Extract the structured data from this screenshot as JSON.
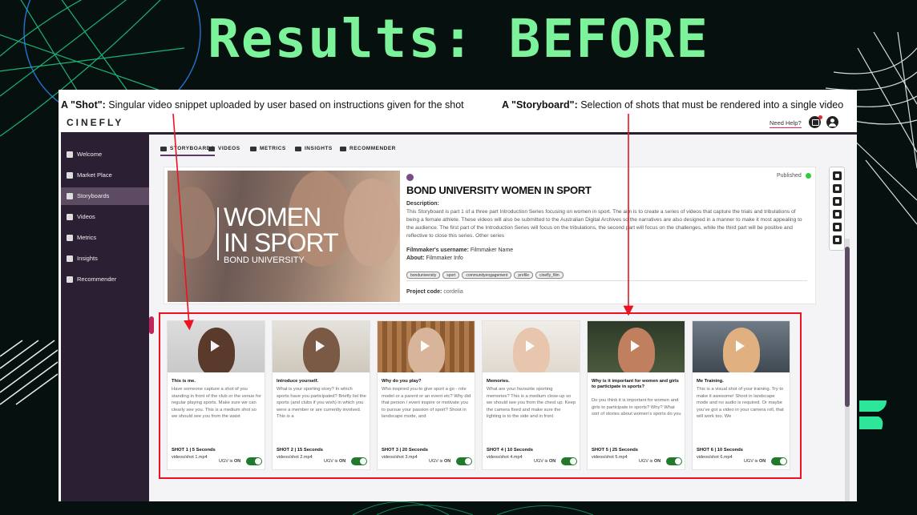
{
  "slide": {
    "title": "Results: BEFORE"
  },
  "annotations": {
    "shot_term": "A \"Shot\":",
    "shot_def": " Singular video snippet uploaded by user based on instructions given for the shot",
    "storyboard_term": "A \"Storyboard\":",
    "storyboard_def": " Selection of shots that must be rendered into a single video"
  },
  "app": {
    "logo": "CINEFLY",
    "need_help": "Need Help?"
  },
  "sidebar": {
    "items": [
      {
        "label": "Welcome",
        "icon": "home-icon"
      },
      {
        "label": "Market Place",
        "icon": "store-icon"
      },
      {
        "label": "Storyboards",
        "icon": "grid-icon",
        "active": true
      },
      {
        "label": "Videos",
        "icon": "video-icon"
      },
      {
        "label": "Metrics",
        "icon": "chart-icon"
      },
      {
        "label": "Insights",
        "icon": "eye-icon"
      },
      {
        "label": "Recommender",
        "icon": "person-icon"
      }
    ]
  },
  "tabs": [
    {
      "label": "STORYBOARDS",
      "active": true
    },
    {
      "label": "VIDEOS"
    },
    {
      "label": "METRICS"
    },
    {
      "label": "INSIGHTS"
    },
    {
      "label": "RECOMMENDER"
    }
  ],
  "storyboard": {
    "hero_line1": "WOMEN",
    "hero_line2": "IN SPORT",
    "hero_sub": "BOND UNIVERSITY",
    "status": "Published",
    "title": "BOND UNIVERSITY WOMEN IN SPORT",
    "description_label": "Description:",
    "description": "This Storyboard is part 1 of a three part Introduction Series focusing on women in sport. The aim is to create a series of videos that capture the trials and tribulations of being a female athlete. These videos will also be submitted to the Australian Digital Archives so the narratives are also designed in a manner to make it most appealing to the audience. The first part of the Introduction Series will focus on the tribulations, the second part will focus on the challenges, while the third part will be positive and reflective to close this series. Other series",
    "filmmaker_label": "Filmmaker's username:",
    "filmmaker_value": "Filmmaker Name",
    "about_label": "About:",
    "about_value": "Filmmaker Info",
    "tags": [
      "bonduniversity",
      "sport",
      "communityengagement",
      "profile",
      "cinefly_film"
    ],
    "project_code_label": "Project code:",
    "project_code_value": "cordelia"
  },
  "ugc": {
    "label": "UGV is",
    "state": "ON"
  },
  "shots": [
    {
      "title": "This is me.",
      "desc": "Have someone capture a shot of you standing in front of the club or the venue for regular playing sports. Make sure we can clearly see you. This is a medium shot so we should see you from the waist",
      "meta": "SHOT 1 | 5 Seconds",
      "file": "videos/shot 1.mp4"
    },
    {
      "title": "Introduce yourself.",
      "desc": "What is your sporting story? In which sports have you participated? Briefly list the sports (and clubs if you wish) in which you were a member or are currently involved. This is a",
      "meta": "SHOT 2 | 15 Seconds",
      "file": "videos/shot 2.mp4"
    },
    {
      "title": "Why do you play?",
      "desc": "Who inspired you to give sport a go - role model or a parent or an event etc? Why did that person / event inspire or motivate you to pursue your passion of sport? Shoot in landscape mode, and",
      "meta": "SHOT 3 | 20 Seconds",
      "file": "videos/shot 3.mp4"
    },
    {
      "title": "Memories.",
      "desc": "What are your favourite sporting memories? This is a medium close-up so we should see you from the chest up. Keep the camera fixed and make sure the lighting is to the side and in front",
      "meta": "SHOT 4 | 10 Seconds",
      "file": "videos/shot 4.mp4"
    },
    {
      "title": "Why is it important for women and girls to participate in sports?",
      "desc": "Do you think it is important for women and girls to participate in sports? Why? What sort of stories about women's sports do you",
      "meta": "SHOT 5 | 25 Seconds",
      "file": "videos/shot 5.mp4"
    },
    {
      "title": "Me Training.",
      "desc": "This is a visual shot of your training. Try to make it awesome! Shoot in landscape mode and no audio is required. Or maybe you've got a video in your camera roll, that will work too. We",
      "meta": "SHOT 6 | 10 Seconds",
      "file": "videos/shot 6.mp4"
    }
  ]
}
